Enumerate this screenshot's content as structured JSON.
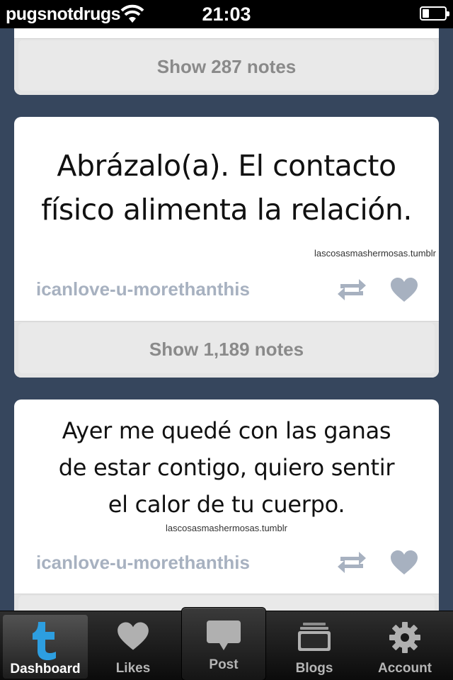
{
  "status_bar": {
    "carrier": "pugsnotdrugs",
    "time": "21:03",
    "battery_level": 0.3
  },
  "posts": [
    {
      "notes_label": "Show 287 notes"
    },
    {
      "quote_lines": [
        "Abrázalo(a). El contacto",
        "físico alimenta la relación."
      ],
      "watermark": "lascosasmashermosas.tumblr",
      "blog_name": "icanlove-u-morethanthis",
      "notes_label": "Show 1,189 notes"
    },
    {
      "quote_lines": [
        "Ayer me quedé con las ganas",
        "de estar contigo, quiero sentir",
        "el calor de tu cuerpo."
      ],
      "watermark": "lascosasmashermosas.tumblr",
      "blog_name": "icanlove-u-morethanthis"
    }
  ],
  "icons": {
    "reblog": "reblog-icon",
    "like": "heart-icon"
  },
  "tabbar": {
    "tabs": [
      {
        "label": "Dashboard",
        "icon": "tumblr-t-icon",
        "active": true
      },
      {
        "label": "Likes",
        "icon": "heart-icon",
        "active": false
      },
      {
        "label": "Post",
        "icon": "speech-bubble-icon",
        "active": false
      },
      {
        "label": "Blogs",
        "icon": "stack-icon",
        "active": false
      },
      {
        "label": "Account",
        "icon": "gear-icon",
        "active": false
      }
    ]
  },
  "colors": {
    "background": "#36465d",
    "blog_name": "#a7b1c0",
    "active_tab_icon": "#2d9ee0"
  }
}
